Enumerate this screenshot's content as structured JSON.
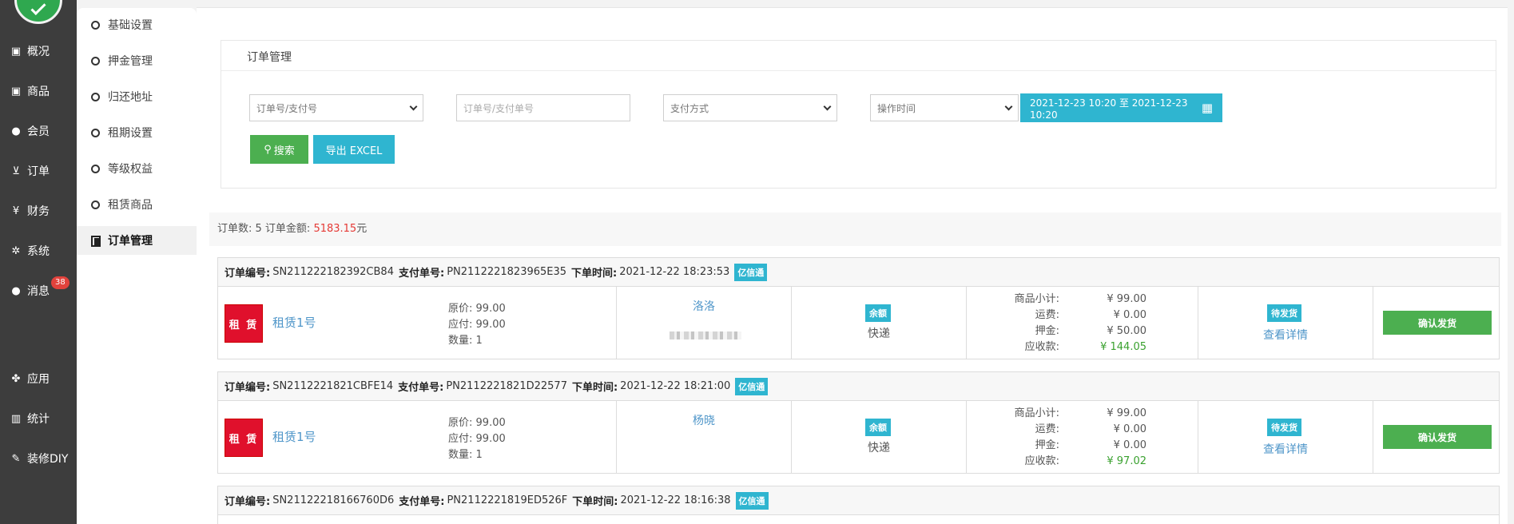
{
  "nav": {
    "items": [
      {
        "label": "概况",
        "icon": "archive-icon"
      },
      {
        "label": "商品",
        "icon": "archive-icon"
      },
      {
        "label": "会员",
        "icon": "users-icon"
      },
      {
        "label": "订单",
        "icon": "cart-icon"
      },
      {
        "label": "财务",
        "icon": "yen-icon"
      },
      {
        "label": "系统",
        "icon": "gears-icon"
      },
      {
        "label": "消息",
        "icon": "chat-icon",
        "badge": "38"
      },
      {
        "label": "应用",
        "icon": "apps-icon"
      },
      {
        "label": "统计",
        "icon": "bar-chart-icon"
      },
      {
        "label": "装修DIY",
        "icon": "hammer-icon"
      }
    ]
  },
  "submenu": {
    "items": [
      "基础设置",
      "押金管理",
      "归还地址",
      "租期设置",
      "等级权益",
      "租赁商品"
    ],
    "active": "订单管理"
  },
  "panel": {
    "title": "订单管理",
    "order_select": "订单号/支付号",
    "order_input_placeholder": "订单号/支付单号",
    "pay_select": "支付方式",
    "time_select": "操作时间",
    "date_range": "2021-12-23 10:20 至 2021-12-23 10:20",
    "search_label": "搜索",
    "export_label": "导出 EXCEL"
  },
  "summary": {
    "prefix": "订单数: 5 订单金额: ",
    "amount": "5183.15",
    "suffix": "元"
  },
  "labels": {
    "order_no": "订单编号:",
    "pay_no": "支付单号:",
    "order_time": "下单时间:",
    "tag": "亿信通",
    "thumb": "租 赁",
    "orig_price": "原价:",
    "payable": "应付:",
    "qty": "数量:",
    "subtotal": "商品小计:",
    "freight": "运费:",
    "deposit": "押金:",
    "receivable": "应收款:",
    "detail": "查看详情",
    "ship": "确认发货"
  },
  "orders": [
    {
      "order_no": "SN211222182392CB84",
      "pay_no": "PN2112221823965E35",
      "time": "2021-12-22 18:23:53",
      "product": "租赁1号",
      "orig_price": "99.00",
      "payable": "99.00",
      "qty": "1",
      "buyer": "洛洛",
      "pay_tag": "余额",
      "pay_text": "快递",
      "subtotal": "¥ 99.00",
      "freight": "¥ 0.00",
      "deposit": "¥ 50.00",
      "receivable": "¥ 144.05",
      "status": "待发货"
    },
    {
      "order_no": "SN2112221821CBFE14",
      "pay_no": "PN2112221821D22577",
      "time": "2021-12-22 18:21:00",
      "product": "租赁1号",
      "orig_price": "99.00",
      "payable": "99.00",
      "qty": "1",
      "buyer": "杨晓",
      "pay_tag": "余额",
      "pay_text": "快递",
      "subtotal": "¥ 99.00",
      "freight": "¥ 0.00",
      "deposit": "¥ 0.00",
      "receivable": "¥ 97.02",
      "status": "待发货"
    },
    {
      "order_no": "SN21122218166760D6",
      "pay_no": "PN2112221819ED526F",
      "time": "2021-12-22 18:16:38"
    }
  ]
}
